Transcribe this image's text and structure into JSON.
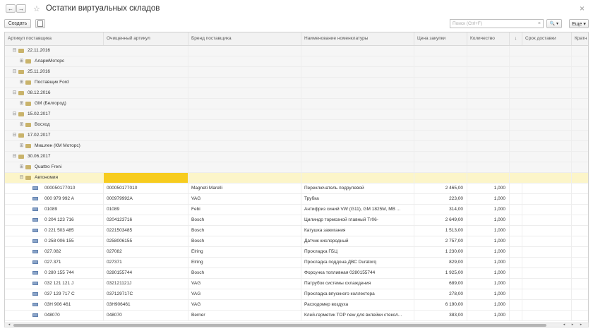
{
  "window": {
    "title": "Остатки виртуальных складов",
    "back_glyph": "←",
    "forward_glyph": "→",
    "star_glyph": "☆",
    "close_glyph": "×"
  },
  "toolbar": {
    "create_label": "Создать",
    "search_placeholder": "Поиск (Ctrl+F)",
    "search_clear": "×",
    "search_btn": "🔍 ▾",
    "more_label": "Еще ▾"
  },
  "columns": [
    "Артикул поставщика",
    "Очищенный артикул",
    "Бренд поставщика",
    "Наименование номенклатуры",
    "Цена закупки",
    "Количество",
    "↓",
    "Срок доставки",
    "Кратн"
  ],
  "groups": [
    {
      "level": 0,
      "label": "22.11.2016",
      "expand": "⊟"
    },
    {
      "level": 1,
      "label": "АлармМоторс",
      "expand": "⊞"
    },
    {
      "level": 0,
      "label": "25.11.2016",
      "expand": "⊟"
    },
    {
      "level": 1,
      "label": "Поставщик Ford",
      "expand": "⊞"
    },
    {
      "level": 0,
      "label": "08.12.2016",
      "expand": "⊟"
    },
    {
      "level": 1,
      "label": "GM (Белгород)",
      "expand": "⊞"
    },
    {
      "level": 0,
      "label": "15.02.2017",
      "expand": "⊟"
    },
    {
      "level": 1,
      "label": "Восход",
      "expand": "⊞"
    },
    {
      "level": 0,
      "label": "17.02.2017",
      "expand": "⊟"
    },
    {
      "level": 1,
      "label": "Мишлен (КМ Моторс)",
      "expand": "⊞"
    },
    {
      "level": 0,
      "label": "30.06.2017",
      "expand": "⊟"
    },
    {
      "level": 1,
      "label": "Quattro Freni",
      "expand": "⊞"
    },
    {
      "level": 1,
      "label": "Автономия",
      "expand": "⊟",
      "selected": true
    }
  ],
  "items": [
    {
      "article": "000050177010",
      "clean": "000050177010",
      "brand": "Magneti Marelli",
      "name": "Переключатель подрулевой",
      "price": "2 465,00",
      "qty": "1,000"
    },
    {
      "article": "000 979 992 A",
      "clean": "000979992A",
      "brand": "VAG",
      "name": "Трубка",
      "price": "223,00",
      "qty": "1,000"
    },
    {
      "article": "01089",
      "clean": "01089",
      "brand": "Febi",
      "name": "Антифриз синий VW (G11), GM 1825M, MB ...",
      "price": "314,00",
      "qty": "1,000"
    },
    {
      "article": "0 204 123 716",
      "clean": "0204123716",
      "brand": "Bosch",
      "name": "Цилиндр тормозной главный Тг06-",
      "price": "2 649,00",
      "qty": "1,000"
    },
    {
      "article": "0 221 503 485",
      "clean": "0221503485",
      "brand": "Bosch",
      "name": "Катушка зажигания",
      "price": "1 513,00",
      "qty": "1,000"
    },
    {
      "article": "0 258 006 155",
      "clean": "0258006155",
      "brand": "Bosch",
      "name": "Датчик кислородный",
      "price": "2 757,00",
      "qty": "1,000"
    },
    {
      "article": "027.082",
      "clean": "027082",
      "brand": "Elring",
      "name": "Прокладка ГБЦ",
      "price": "1 230,00",
      "qty": "1,000"
    },
    {
      "article": "027.371",
      "clean": "027371",
      "brand": "Elring",
      "name": "Прокладка поддона ДВС Duratorq",
      "price": "829,00",
      "qty": "1,000"
    },
    {
      "article": "0 280 155 744",
      "clean": "0280155744",
      "brand": "Bosch",
      "name": "Форсунка топливная 0280155744",
      "price": "1 925,00",
      "qty": "1,000"
    },
    {
      "article": "032 121 121 J",
      "clean": "032121121J",
      "brand": "VAG",
      "name": "Патрубок системы охлаждения",
      "price": "689,00",
      "qty": "1,000"
    },
    {
      "article": "037 129 717 C",
      "clean": "037129717C",
      "brand": "VAG",
      "name": "Прокладка впускного коллектора",
      "price": "278,00",
      "qty": "1,000"
    },
    {
      "article": "03H 906 461",
      "clean": "03H906461",
      "brand": "VAG",
      "name": "Расходомер воздуха",
      "price": "6 190,00",
      "qty": "1,000"
    },
    {
      "article": "048070",
      "clean": "048070",
      "brand": "Berner",
      "name": "Клей-герметик TOP new для вклейки стекол...",
      "price": "383,00",
      "qty": "1,000"
    }
  ],
  "colors": {
    "group_bg": "#f6f6f6",
    "selected_group_bg": "#fcf5c9",
    "highlight": "#f7cc1e"
  },
  "scrollbar": {
    "left": "◂",
    "right": "▸"
  }
}
